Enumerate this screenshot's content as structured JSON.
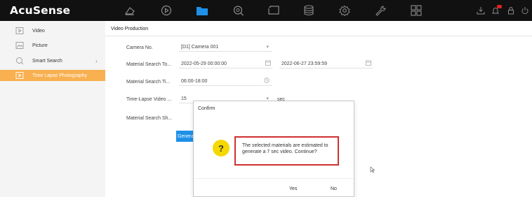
{
  "app": {
    "logo": "AcuSense"
  },
  "nav": {
    "icons": [
      "live-view-icon",
      "playback-icon",
      "file-folder-icon",
      "smart-search-icon",
      "screen-icon",
      "storage-icon",
      "settings-icon",
      "maintenance-icon",
      "apps-grid-icon"
    ],
    "active": "file-folder-icon",
    "active_color": "#1e90e8"
  },
  "sidebar": {
    "items": [
      {
        "label": "Video",
        "icon": "video-icon"
      },
      {
        "label": "Picture",
        "icon": "picture-icon"
      },
      {
        "label": "Smart Search",
        "icon": "smart-search-icon",
        "chevron": "›"
      },
      {
        "label": "Time Lapse Photography",
        "icon": "time-lapse-icon",
        "active": true
      }
    ],
    "active_color": "#f8b050"
  },
  "main": {
    "tab": "Video Production",
    "fields": {
      "camera_label": "Camera No.",
      "camera_value": "[D1] Camera 001",
      "camera_arrow": "▾",
      "time_label": "Material Search To...",
      "time_start": "2022-05-29 00:00:00",
      "time_end": "2022-06-27 23:59:59",
      "search_time_label": "Material Search Ti...",
      "search_time_value": "06:00-18:00",
      "video_label": "Time-Lapse Video ...",
      "video_value": "15",
      "video_unit": "sec",
      "video_arrow": "▾",
      "search_sh_label": "Material Search Sh..."
    },
    "generate_label": "Generate"
  },
  "dialog": {
    "title": "Confirm",
    "question_mark": "?",
    "message": "The selected materials are estimated to generate a 7 sec video. Continue?",
    "yes_label": "Yes",
    "no_label": "No",
    "highlight_color": "#d03030",
    "icon_color": "#f5d800"
  }
}
